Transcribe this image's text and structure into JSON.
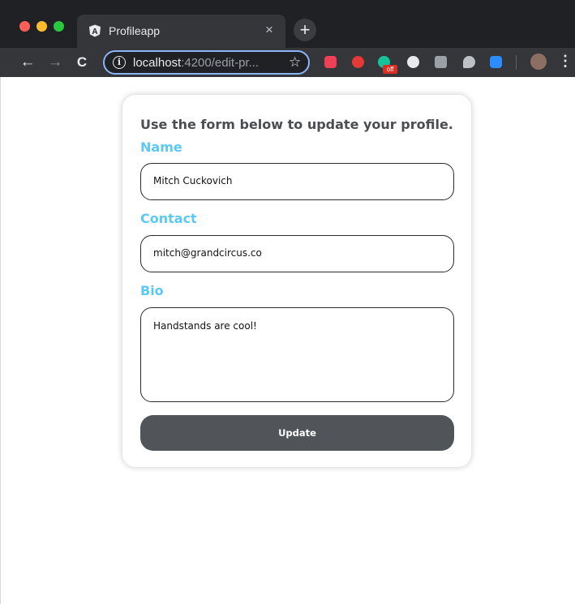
{
  "browser": {
    "tab": {
      "title": "Profileapp",
      "close_glyph": "×",
      "logo_letter": "A"
    },
    "new_tab_glyph": "+",
    "toolbar": {
      "back_glyph": "←",
      "forward_glyph": "→",
      "reload_glyph": "C",
      "url_host": "localhost",
      "url_rest": ":4200/edit-pr...",
      "star_glyph": "☆",
      "menu_glyph": "⋮",
      "extension_badge": "off"
    }
  },
  "form": {
    "heading": "Use the form below to update your profile.",
    "name": {
      "label": "Name",
      "value": "Mitch Cuckovich"
    },
    "contact": {
      "label": "Contact",
      "value": "mitch@grandcircus.co"
    },
    "bio": {
      "label": "Bio",
      "value": "Handstands are cool!"
    },
    "submit_label": "Update"
  },
  "colors": {
    "label_accent": "#5bc9f2",
    "button_bg": "#515458",
    "heading_text": "#4a4d52"
  }
}
